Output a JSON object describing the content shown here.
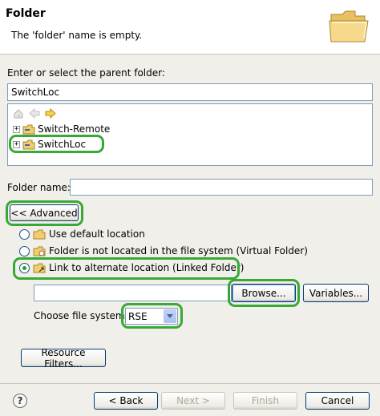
{
  "header": {
    "title": "Folder",
    "message": "The 'folder' name is empty."
  },
  "parent_folder": {
    "label": "Enter or select the parent folder:",
    "value": "SwitchLoc"
  },
  "tree": {
    "toolbar_icons": [
      "home-icon",
      "back-arrow-icon",
      "forward-arrow-icon"
    ],
    "items": [
      {
        "label": "Switch-Remote"
      },
      {
        "label": "SwitchLoc"
      }
    ]
  },
  "folder_name": {
    "label": "Folder name:",
    "value": ""
  },
  "advanced_button": "<< Advanced",
  "location_options": [
    {
      "label": "Use default location",
      "selected": false
    },
    {
      "label": "Folder is not located in the file system (Virtual Folder)",
      "selected": false
    },
    {
      "label": "Link to alternate location (Linked Folder)",
      "selected": true
    }
  ],
  "location": {
    "value": "",
    "browse_label": "Browse...",
    "variables_label": "Variables..."
  },
  "file_system": {
    "label": "Choose file system:",
    "value": "RSE"
  },
  "resource_filters_label": "Resource Filters...",
  "footer": {
    "help_glyph": "?",
    "back_label": "< Back",
    "next_label": "Next >",
    "finish_label": "Finish",
    "cancel_label": "Cancel"
  },
  "colors": {
    "highlight": "#39a935",
    "accent": "#003c74"
  }
}
